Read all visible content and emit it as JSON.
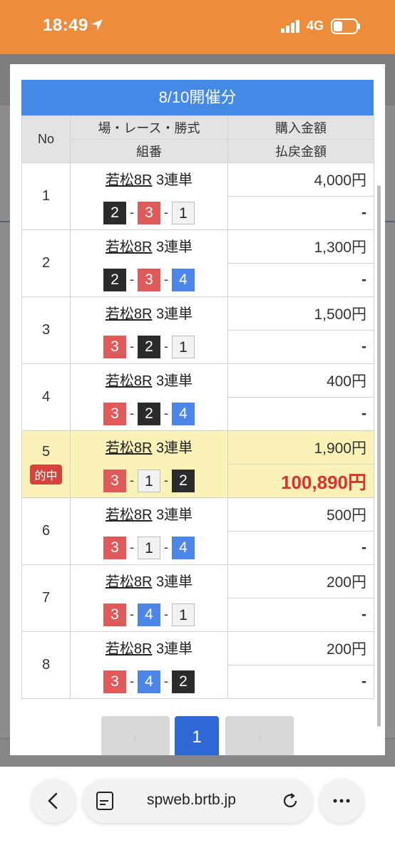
{
  "status": {
    "time": "18:49",
    "network": "4G"
  },
  "modal": {
    "title": "8/10開催分",
    "headers": {
      "no": "No",
      "race_type": "場・レース・勝式",
      "combo": "組番",
      "purchase": "購入金額",
      "payout": "払戻金額"
    },
    "rows": [
      {
        "no": "1",
        "venue": "若松8R",
        "type": "3連単",
        "combo": [
          "2",
          "3",
          "1"
        ],
        "purchase": "4,000円",
        "payout": "-",
        "hit": false
      },
      {
        "no": "2",
        "venue": "若松8R",
        "type": "3連単",
        "combo": [
          "2",
          "3",
          "4"
        ],
        "purchase": "1,300円",
        "payout": "-",
        "hit": false
      },
      {
        "no": "3",
        "venue": "若松8R",
        "type": "3連単",
        "combo": [
          "3",
          "2",
          "1"
        ],
        "purchase": "1,500円",
        "payout": "-",
        "hit": false
      },
      {
        "no": "4",
        "venue": "若松8R",
        "type": "3連単",
        "combo": [
          "3",
          "2",
          "4"
        ],
        "purchase": "400円",
        "payout": "-",
        "hit": false
      },
      {
        "no": "5",
        "venue": "若松8R",
        "type": "3連単",
        "combo": [
          "3",
          "1",
          "2"
        ],
        "purchase": "1,900円",
        "payout": "100,890円",
        "hit": true,
        "hit_label": "的中"
      },
      {
        "no": "6",
        "venue": "若松8R",
        "type": "3連単",
        "combo": [
          "3",
          "1",
          "4"
        ],
        "purchase": "500円",
        "payout": "-",
        "hit": false
      },
      {
        "no": "7",
        "venue": "若松8R",
        "type": "3連単",
        "combo": [
          "3",
          "4",
          "1"
        ],
        "purchase": "200円",
        "payout": "-",
        "hit": false
      },
      {
        "no": "8",
        "venue": "若松8R",
        "type": "3連単",
        "combo": [
          "3",
          "4",
          "2"
        ],
        "purchase": "200円",
        "payout": "-",
        "hit": false
      }
    ],
    "separator": "-",
    "pager": {
      "prev": "‹",
      "current": "1",
      "next": "›"
    }
  },
  "browser": {
    "url": "spweb.brtb.jp"
  },
  "colors": {
    "accent": "#4589e6",
    "status_bar": "#ed8c3a",
    "hit_bg": "#fbf2b8",
    "hit_text": "#e0302a"
  }
}
